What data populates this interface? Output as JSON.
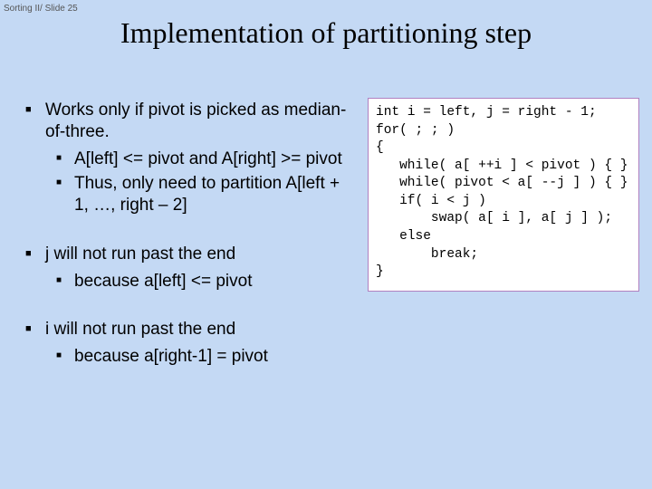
{
  "header": {
    "label": "Sorting II/ Slide 25"
  },
  "title": "Implementation of partitioning step",
  "bullets": {
    "g1": {
      "main": "Works only if pivot is picked as median-of-three.",
      "sub1": "A[left] <= pivot and A[right] >= pivot",
      "sub2": "Thus, only need to partition A[left + 1, …, right – 2]"
    },
    "g2": {
      "main": "j will not run past the end",
      "sub1": "because a[left] <= pivot"
    },
    "g3": {
      "main": "i will not run past the end",
      "sub1": "because a[right-1] = pivot"
    }
  },
  "code": "int i = left, j = right - 1;\nfor( ; ; )\n{\n   while( a[ ++i ] < pivot ) { }\n   while( pivot < a[ --j ] ) { }\n   if( i < j )\n       swap( a[ i ], a[ j ] );\n   else\n       break;\n}"
}
